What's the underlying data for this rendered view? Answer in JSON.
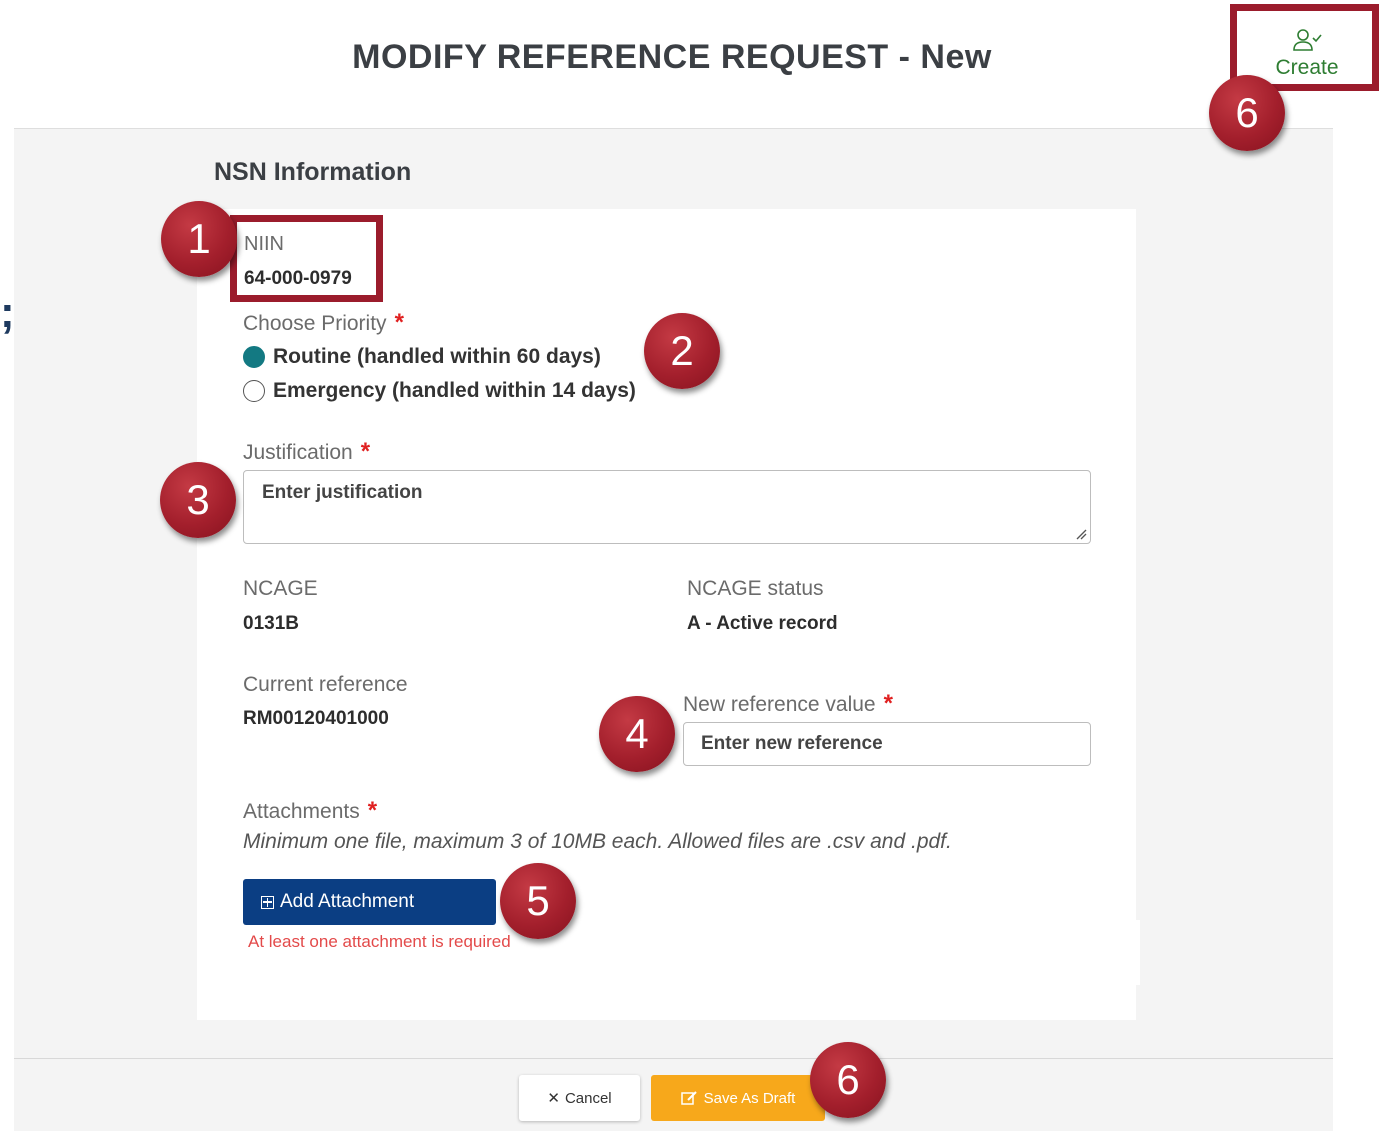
{
  "page": {
    "title": "MODIFY REFERENCE REQUEST - New"
  },
  "header": {
    "create_label": "Create",
    "edge_mark": ";"
  },
  "section": {
    "title": "NSN Information"
  },
  "niin": {
    "label": "NIIN",
    "value": "64-000-0979"
  },
  "priority": {
    "label": "Choose Priority",
    "required_mark": "*",
    "options": [
      {
        "label": "Routine (handled within 60 days)",
        "selected": true
      },
      {
        "label": "Emergency (handled within 14 days)",
        "selected": false
      }
    ]
  },
  "justification": {
    "label": "Justification",
    "required_mark": "*",
    "placeholder": "Enter justification"
  },
  "ncage": {
    "label": "NCAGE",
    "value": "0131B"
  },
  "ncage_status": {
    "label": "NCAGE status",
    "value": "A - Active record"
  },
  "current_reference": {
    "label": "Current reference",
    "value": "RM00120401000"
  },
  "new_reference": {
    "label": "New reference value",
    "required_mark": "*",
    "placeholder": "Enter new reference"
  },
  "attachments": {
    "label": "Attachments",
    "required_mark": "*",
    "hint": "Minimum one file, maximum 3 of 10MB each. Allowed files are .csv and .pdf.",
    "add_label": "Add Attachment",
    "error": "At least one attachment is required"
  },
  "footer": {
    "cancel_label": "Cancel",
    "draft_label": "Save As Draft"
  },
  "callouts": [
    "1",
    "2",
    "3",
    "4",
    "5",
    "6",
    "6"
  ],
  "colors": {
    "accent_teal": "#137982",
    "primary_blue": "#0b3e83",
    "draft_orange": "#f7a81b",
    "create_green": "#2e7d32",
    "callout_red": "#a31f2c",
    "error_red": "#e34a4a"
  }
}
